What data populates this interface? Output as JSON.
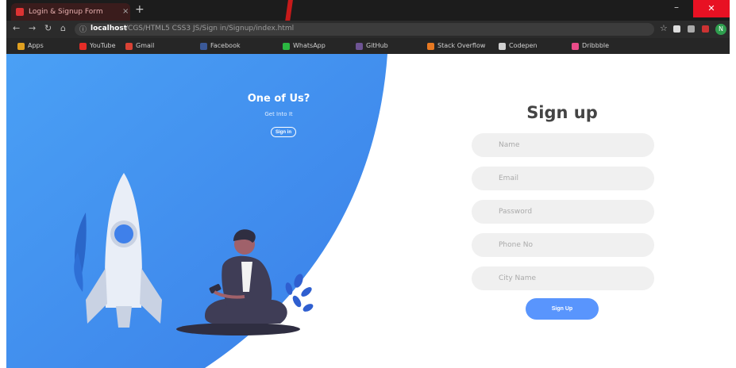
{
  "browser": {
    "tab_title": "Login & Signup Form",
    "tab_close": "×",
    "new_tab": "+",
    "window_min": "–",
    "window_close": "✕",
    "url_host": "localhost",
    "url_path": "/CGS/HTML5 CSS3 JS/Sign in/Signup/index.html",
    "avatar": "N",
    "bookmarks": [
      {
        "label": "Apps",
        "color": "#e0a020"
      },
      {
        "label": "YouTube",
        "color": "#e52d27"
      },
      {
        "label": "Gmail",
        "color": "#d94235"
      },
      {
        "label": "Facebook",
        "color": "#3b5998"
      },
      {
        "label": "WhatsApp",
        "color": "#2bb741"
      },
      {
        "label": "GitHub",
        "color": "#6e5494"
      },
      {
        "label": "Stack Overflow",
        "color": "#e87922"
      },
      {
        "label": "Codepen",
        "color": "#d0d0d0"
      },
      {
        "label": "Dribbble",
        "color": "#ea4c89"
      }
    ]
  },
  "hero": {
    "title": "One of Us?",
    "subtitle": "Get Into It",
    "button_label": "Sign in"
  },
  "form": {
    "title": "Sign up",
    "fields": [
      {
        "placeholder": "Name"
      },
      {
        "placeholder": "Email"
      },
      {
        "placeholder": "Password"
      },
      {
        "placeholder": "Phone No"
      },
      {
        "placeholder": "City Name"
      }
    ],
    "submit_label": "Sign Up"
  },
  "colors": {
    "blue_panel": "#3f88ee",
    "blue_panel_light": "#4fa3f6",
    "button_blue": "#5995fd",
    "field_bg": "#f0f0f0"
  }
}
